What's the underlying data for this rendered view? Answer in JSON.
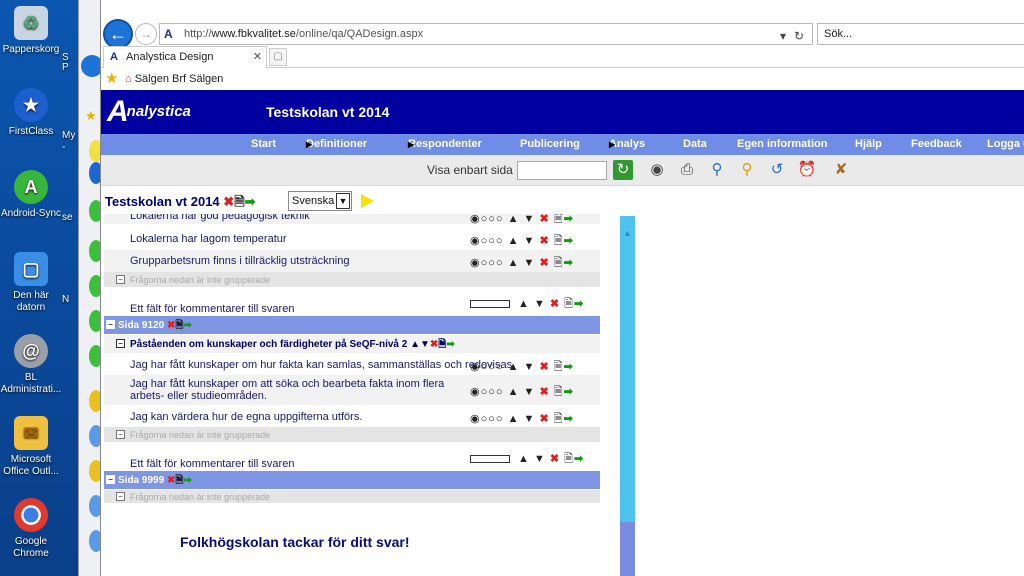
{
  "desktop": {
    "icons": [
      {
        "label": "Papperskorg",
        "icon": "recycle-bin-icon",
        "color": "#d0dce8"
      },
      {
        "label": "FirstClass",
        "icon": "firstclass-icon",
        "color": "#1e5fd0"
      },
      {
        "label": "Android-Sync",
        "icon": "android-sync-icon",
        "color": "#38b53b"
      },
      {
        "label": "Den här datorn",
        "icon": "computer-icon",
        "color": "#3a8ee6"
      },
      {
        "label": "BL Administrati...",
        "icon": "bl-admin-icon",
        "color": "#9aa0a6"
      },
      {
        "label": "Microsoft Office Outl...",
        "icon": "outlook-icon",
        "color": "#f0c040"
      },
      {
        "label": "Google Chrome",
        "icon": "chrome-icon",
        "color": "#ffffff"
      }
    ],
    "partial_labels": [
      "S",
      "P",
      "My",
      "-",
      "se",
      "N"
    ]
  },
  "browser": {
    "url_host": "www.fbkvalitet.se",
    "url_prefix": "http://",
    "url_path": "/online/qa/QADesign.aspx",
    "search_placeholder": "Sök...",
    "tab_title": "Analystica Design",
    "favorites": "Sälgen  Brf Sälgen"
  },
  "app": {
    "logo": "nalystica",
    "logo_a": "A",
    "title": "Testskolan vt 2014",
    "menu": [
      {
        "label": "Start",
        "submenu": false
      },
      {
        "label": "Definitioner",
        "submenu": true
      },
      {
        "label": "Respondenter",
        "submenu": true
      },
      {
        "label": "Publicering",
        "submenu": false
      },
      {
        "label": "Analys",
        "submenu": true
      },
      {
        "label": "Data",
        "submenu": false
      },
      {
        "label": "Egen information",
        "submenu": false
      },
      {
        "label": "Hjälp",
        "submenu": false
      },
      {
        "label": "Feedback",
        "submenu": false
      },
      {
        "label": "Logga u",
        "submenu": false
      }
    ],
    "show_only_page_label": "Visa enbart sida",
    "survey_title": "Testskolan vt 2014",
    "language_value": "Svenska",
    "thanks": "Folkhögskolan tackar för ditt svar!"
  },
  "questions": {
    "q_top_cut": "Lokalerna har god pedagogisk teknik",
    "q1": "Lokalerna har lagom temperatur",
    "q2": "Grupparbetsrum finns i tillräcklig utsträckning",
    "group_note_1": "Frågorna nedan är inte grupperade",
    "comment_1": "Ett fält för kommentarer till svaren",
    "page_9120": "Sida 9120",
    "section_seqf": "Påståenden om kunskaper och färdigheter på SeQF-nivå 2",
    "q3": "Jag har fått kunskaper om hur fakta kan samlas, sammanställas och redovisas.",
    "q4": "Jag har fått kunskaper om att söka och bearbeta fakta inom flera arbets- eller studieområden.",
    "q5": "Jag kan värdera hur de egna uppgifterna utförs.",
    "group_note_2": "Frågorna nedan är inte grupperade",
    "comment_2": "Ett fält för kommentarer till svaren",
    "page_9999": "Sida 9999",
    "group_note_3": "Frågorna nedan är inte grupperade"
  }
}
